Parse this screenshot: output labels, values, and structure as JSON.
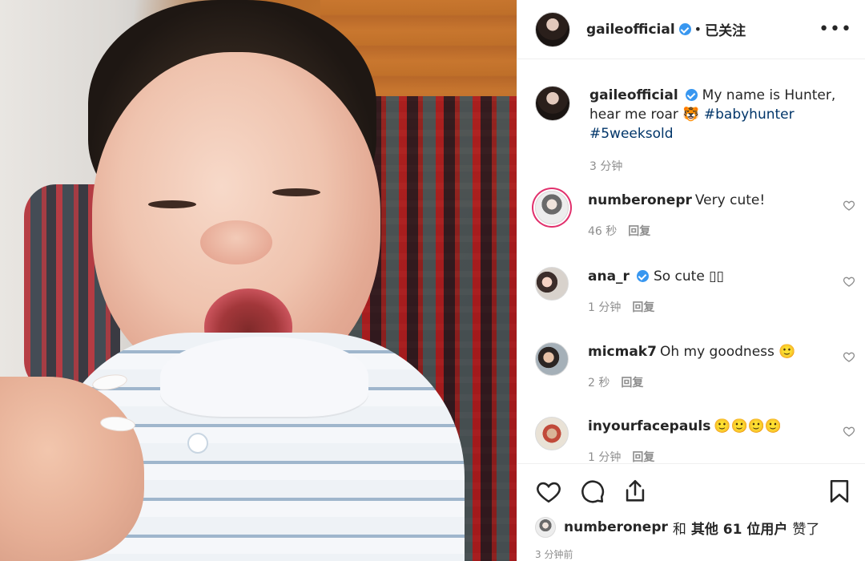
{
  "post": {
    "author": "gaileofficial",
    "follow_separator": "•",
    "follow_status": "已关注",
    "more_label": "•••",
    "caption": {
      "username": "gaileofficial",
      "text": "My name is Hunter, hear me roar 🐯 ",
      "hashtags": [
        "#babyhunter",
        "#5weeksold"
      ],
      "time": "3 分钟"
    }
  },
  "comments": [
    {
      "username": "numberonepr",
      "verified": false,
      "text": "Very cute!",
      "time": "46 秒",
      "reply_label": "回复"
    },
    {
      "username": "ana_r",
      "verified": true,
      "text": "So cute ▯▯",
      "time": "1 分钟",
      "reply_label": "回复"
    },
    {
      "username": "micmak7",
      "verified": false,
      "text": "Oh my goodness 🙂",
      "time": "2 秒",
      "reply_label": "回复"
    },
    {
      "username": "inyourfacepauls",
      "verified": false,
      "text": "🙂🙂🙂🙂",
      "time": "1 分钟",
      "reply_label": "回复"
    }
  ],
  "footer": {
    "liked_by_user": "numberonepr",
    "liked_connector": "和",
    "liked_others": "其他 61 位用户",
    "liked_suffix": "赞了",
    "timestamp": "3 分钟前"
  },
  "icons": {
    "like": "heart-icon",
    "comment": "comment-icon",
    "share": "share-icon",
    "save": "bookmark-icon",
    "verified": "verified-badge-icon"
  },
  "colors": {
    "verified": "#3897f0",
    "hashtag": "#003569",
    "muted": "#8e8e8e",
    "text": "#262626"
  }
}
